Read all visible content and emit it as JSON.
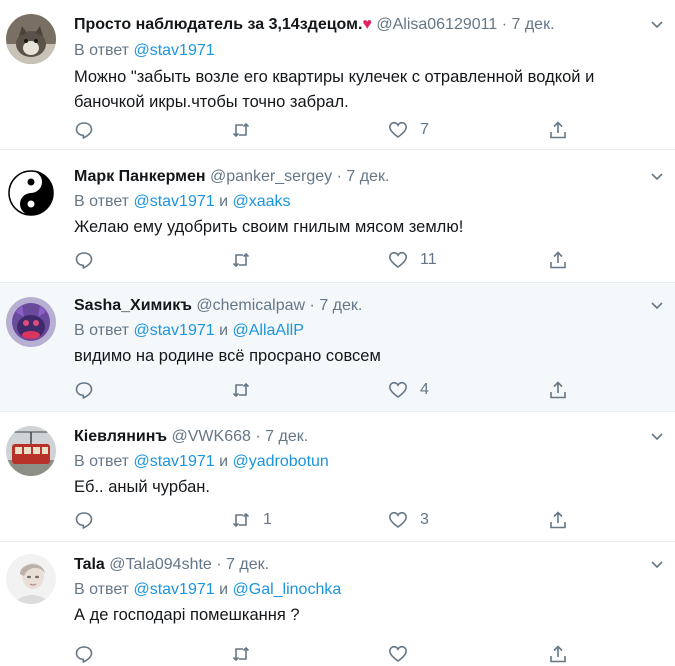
{
  "reply_prefix": "В ответ",
  "conj": "и",
  "dot": "·",
  "tweets": [
    {
      "name": "Просто наблюдатель за 3,14здецом.",
      "name_emoji": "♥",
      "handle": "@Alisa06129011",
      "date": "7 дек.",
      "mentions": [
        "@stav1971"
      ],
      "text": "Можно \"забыть возле его квартиры кулечек с отравленной водкой и баночкой икры.чтобы точно забрал.",
      "replies": "",
      "retweets": "",
      "likes": "7",
      "avatar_icon": "cat-avatar"
    },
    {
      "name": "Марк Панкермен",
      "handle": "@panker_sergey",
      "date": "7 дек.",
      "mentions": [
        "@stav1971",
        "@xaaks"
      ],
      "text": "Желаю ему удобрить своим гнилым мясом землю!",
      "replies": "",
      "retweets": "",
      "likes": "11",
      "avatar_icon": "yin-yang-avatar"
    },
    {
      "name": "Sasha_Химикъ",
      "handle": "@chemicalpaw",
      "date": "7 дек.",
      "mentions": [
        "@stav1971",
        "@AllaAllP"
      ],
      "text": "видимо на родине всё просрано совсем",
      "replies": "",
      "retweets": "",
      "likes": "4",
      "avatar_icon": "creature-avatar"
    },
    {
      "name": "Кіевлянинъ",
      "handle": "@VWK668",
      "date": "7 дек.",
      "mentions": [
        "@stav1971",
        "@yadrobotun"
      ],
      "text": "Еб.. аный чурбан.",
      "replies": "",
      "retweets": "1",
      "likes": "3",
      "avatar_icon": "tram-avatar"
    },
    {
      "name": "Tala",
      "handle": "@Tala094shte",
      "date": "7 дек.",
      "mentions": [
        "@stav1971",
        "@Gal_linochka"
      ],
      "text": "А де господарі помешкання ?",
      "replies": "",
      "retweets": "",
      "likes": "",
      "avatar_icon": "portrait-avatar"
    }
  ],
  "colors": {
    "text": "#14171a",
    "secondary": "#657786",
    "link": "#1b95e0",
    "highlight_bg": "#f5f8fa",
    "divider": "#e6ecf0",
    "heart": "#e0245e"
  }
}
